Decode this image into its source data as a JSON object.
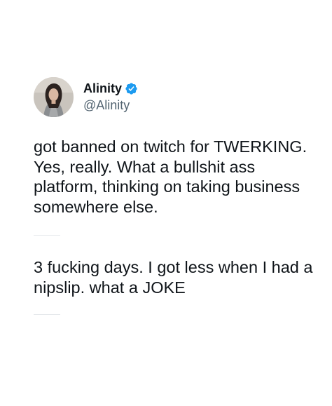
{
  "tweet": {
    "author": {
      "display_name": "Alinity",
      "handle": "@Alinity",
      "verified_icon": "verified-badge-icon",
      "verified_color": "#1d9bf0"
    },
    "paragraphs": [
      "got banned on twitch for TWERKING. Yes, really. What a bullshit ass platform, thinking on taking business somewhere else.",
      "3 fucking days. I got less when I had a nipslip. what a JOKE"
    ]
  }
}
